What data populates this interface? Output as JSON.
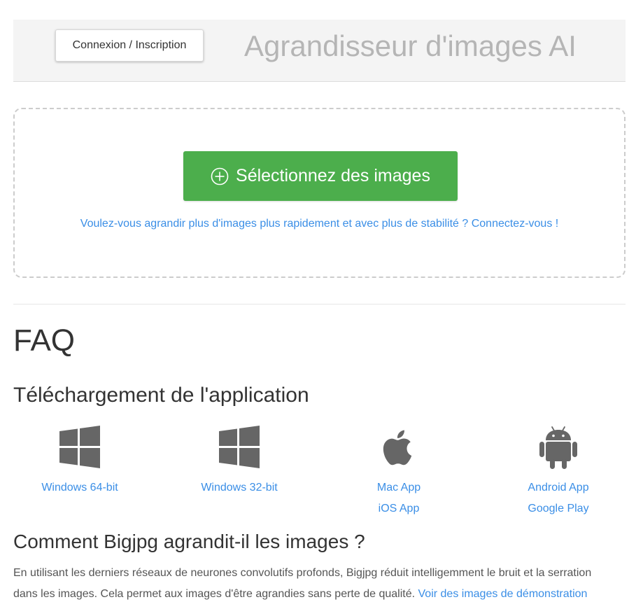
{
  "header": {
    "login_label": "Connexion / Inscription",
    "app_title": "Agrandisseur d'images AI"
  },
  "upload": {
    "select_label": "Sélectionnez des images",
    "login_hint": "Voulez-vous agrandir plus d'images plus rapidement et avec plus de stabilité ? Connectez-vous !"
  },
  "faq": {
    "title": "FAQ",
    "download_title": "Téléchargement de l'application",
    "apps": [
      {
        "icon": "windows-icon",
        "links": [
          "Windows 64-bit"
        ]
      },
      {
        "icon": "windows-icon",
        "links": [
          "Windows 32-bit"
        ]
      },
      {
        "icon": "apple-icon",
        "links": [
          "Mac App",
          "iOS App"
        ]
      },
      {
        "icon": "android-icon",
        "links": [
          "Android App",
          "Google Play"
        ]
      }
    ],
    "how_title": "Comment Bigjpg agrandit-il les images ?",
    "how_text": "En utilisant les derniers réseaux de neurones convolutifs profonds, Bigjpg réduit intelligemment le bruit et la serration dans les images. Cela permet aux images d'être agrandies sans perte de qualité.",
    "demo_link": "Voir des images de démonstration"
  },
  "colors": {
    "primary_button": "#4cae4c",
    "link": "#3a8ee6",
    "icon": "#666666"
  }
}
